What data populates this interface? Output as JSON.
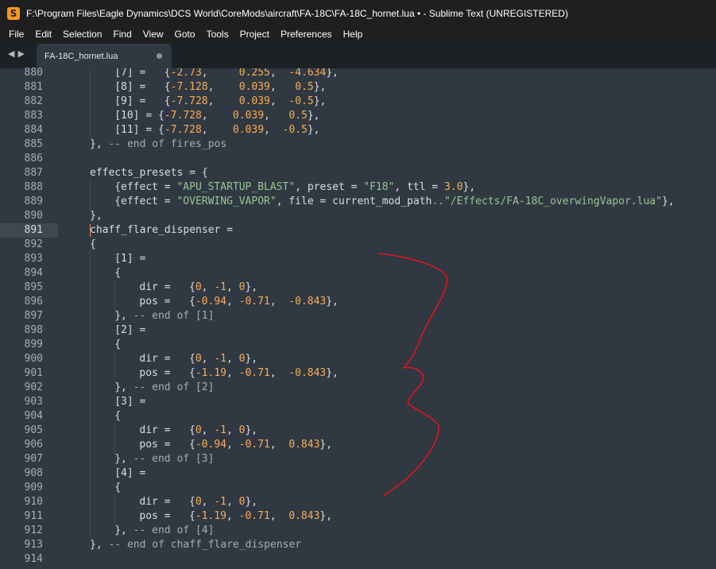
{
  "window": {
    "title": "F:\\Program Files\\Eagle Dynamics\\DCS World\\CoreMods\\aircraft\\FA-18C\\FA-18C_hornet.lua • - Sublime Text (UNREGISTERED)",
    "app_icon_letter": "S",
    "app_icon_color": "#f79a1f"
  },
  "menu": [
    "File",
    "Edit",
    "Selection",
    "Find",
    "View",
    "Goto",
    "Tools",
    "Project",
    "Preferences",
    "Help"
  ],
  "tabs": [
    {
      "label": "FA-18C_hornet.lua",
      "modified": true
    }
  ],
  "nav": {
    "back": "◀",
    "forward": "▶"
  },
  "editor": {
    "current_line": 891,
    "colors": {
      "background": "#303841",
      "number": "#f9ae58",
      "string": "#99c794",
      "comment": "#a6acb9",
      "text": "#d8dee9"
    },
    "lines": [
      {
        "n": 880,
        "indent": 2,
        "tokens": [
          [
            "t",
            "[7] =   {"
          ],
          [
            "n",
            "-2.73"
          ],
          [
            "t",
            ",     "
          ],
          [
            "n",
            "0.255"
          ],
          [
            "t",
            ",  "
          ],
          [
            "n",
            "-4.634"
          ],
          [
            "t",
            "},"
          ]
        ]
      },
      {
        "n": 881,
        "indent": 2,
        "tokens": [
          [
            "t",
            "[8] =   {"
          ],
          [
            "n",
            "-7.128"
          ],
          [
            "t",
            ",    "
          ],
          [
            "n",
            "0.039"
          ],
          [
            "t",
            ",   "
          ],
          [
            "n",
            "0.5"
          ],
          [
            "t",
            "},"
          ]
        ]
      },
      {
        "n": 882,
        "indent": 2,
        "tokens": [
          [
            "t",
            "[9] =   {"
          ],
          [
            "n",
            "-7.728"
          ],
          [
            "t",
            ",    "
          ],
          [
            "n",
            "0.039"
          ],
          [
            "t",
            ",  "
          ],
          [
            "n",
            "-0.5"
          ],
          [
            "t",
            "},"
          ]
        ]
      },
      {
        "n": 883,
        "indent": 2,
        "tokens": [
          [
            "t",
            "[10] = {"
          ],
          [
            "n",
            "-7.728"
          ],
          [
            "t",
            ",    "
          ],
          [
            "n",
            "0.039"
          ],
          [
            "t",
            ",   "
          ],
          [
            "n",
            "0.5"
          ],
          [
            "t",
            "},"
          ]
        ]
      },
      {
        "n": 884,
        "indent": 2,
        "tokens": [
          [
            "t",
            "[11] = {"
          ],
          [
            "n",
            "-7.728"
          ],
          [
            "t",
            ",    "
          ],
          [
            "n",
            "0.039"
          ],
          [
            "t",
            ",  "
          ],
          [
            "n",
            "-0.5"
          ],
          [
            "t",
            "},"
          ]
        ]
      },
      {
        "n": 885,
        "indent": 1,
        "tokens": [
          [
            "t",
            "}, "
          ],
          [
            "c",
            "-- end of fires_pos"
          ]
        ]
      },
      {
        "n": 886,
        "indent": 0,
        "tokens": []
      },
      {
        "n": 887,
        "indent": 1,
        "tokens": [
          [
            "t",
            "effects_presets = {"
          ]
        ]
      },
      {
        "n": 888,
        "indent": 2,
        "tokens": [
          [
            "t",
            "{effect = "
          ],
          [
            "s",
            "\"APU_STARTUP_BLAST\""
          ],
          [
            "t",
            ", preset = "
          ],
          [
            "s",
            "\"F18\""
          ],
          [
            "t",
            ", ttl = "
          ],
          [
            "n",
            "3.0"
          ],
          [
            "t",
            "},"
          ]
        ]
      },
      {
        "n": 889,
        "indent": 2,
        "tokens": [
          [
            "t",
            "{effect = "
          ],
          [
            "s",
            "\"OVERWING_VAPOR\""
          ],
          [
            "t",
            ", file = current_mod_path"
          ],
          [
            "c",
            ".."
          ],
          [
            "s",
            "\"/Effects/FA-18C_overwingVapor.lua\""
          ],
          [
            "t",
            "},"
          ]
        ]
      },
      {
        "n": 890,
        "indent": 1,
        "tokens": [
          [
            "t",
            "},"
          ]
        ]
      },
      {
        "n": 891,
        "indent": 1,
        "tokens": [
          [
            "t",
            "chaff_flare_dispenser = "
          ]
        ]
      },
      {
        "n": 892,
        "indent": 1,
        "tokens": [
          [
            "t",
            "{"
          ]
        ]
      },
      {
        "n": 893,
        "indent": 2,
        "tokens": [
          [
            "t",
            "[1] = "
          ]
        ]
      },
      {
        "n": 894,
        "indent": 2,
        "tokens": [
          [
            "t",
            "{"
          ]
        ]
      },
      {
        "n": 895,
        "indent": 3,
        "tokens": [
          [
            "t",
            "dir =   {"
          ],
          [
            "n",
            "0"
          ],
          [
            "t",
            ", "
          ],
          [
            "n",
            "-1"
          ],
          [
            "t",
            ", "
          ],
          [
            "n",
            "0"
          ],
          [
            "t",
            "},"
          ]
        ]
      },
      {
        "n": 896,
        "indent": 3,
        "tokens": [
          [
            "t",
            "pos =   {"
          ],
          [
            "n",
            "-0.94"
          ],
          [
            "t",
            ", "
          ],
          [
            "n",
            "-0.71"
          ],
          [
            "t",
            ",  "
          ],
          [
            "n",
            "-0.843"
          ],
          [
            "t",
            "},"
          ]
        ]
      },
      {
        "n": 897,
        "indent": 2,
        "tokens": [
          [
            "t",
            "}, "
          ],
          [
            "c",
            "-- end of [1]"
          ]
        ]
      },
      {
        "n": 898,
        "indent": 2,
        "tokens": [
          [
            "t",
            "[2] = "
          ]
        ]
      },
      {
        "n": 899,
        "indent": 2,
        "tokens": [
          [
            "t",
            "{"
          ]
        ]
      },
      {
        "n": 900,
        "indent": 3,
        "tokens": [
          [
            "t",
            "dir =   {"
          ],
          [
            "n",
            "0"
          ],
          [
            "t",
            ", "
          ],
          [
            "n",
            "-1"
          ],
          [
            "t",
            ", "
          ],
          [
            "n",
            "0"
          ],
          [
            "t",
            "},"
          ]
        ]
      },
      {
        "n": 901,
        "indent": 3,
        "tokens": [
          [
            "t",
            "pos =   {"
          ],
          [
            "n",
            "-1.19"
          ],
          [
            "t",
            ", "
          ],
          [
            "n",
            "-0.71"
          ],
          [
            "t",
            ",  "
          ],
          [
            "n",
            "-0.843"
          ],
          [
            "t",
            "},"
          ]
        ]
      },
      {
        "n": 902,
        "indent": 2,
        "tokens": [
          [
            "t",
            "}, "
          ],
          [
            "c",
            "-- end of [2]"
          ]
        ]
      },
      {
        "n": 903,
        "indent": 2,
        "tokens": [
          [
            "t",
            "[3] = "
          ]
        ]
      },
      {
        "n": 904,
        "indent": 2,
        "tokens": [
          [
            "t",
            "{"
          ]
        ]
      },
      {
        "n": 905,
        "indent": 3,
        "tokens": [
          [
            "t",
            "dir =   {"
          ],
          [
            "n",
            "0"
          ],
          [
            "t",
            ", "
          ],
          [
            "n",
            "-1"
          ],
          [
            "t",
            ", "
          ],
          [
            "n",
            "0"
          ],
          [
            "t",
            "},"
          ]
        ]
      },
      {
        "n": 906,
        "indent": 3,
        "tokens": [
          [
            "t",
            "pos =   {"
          ],
          [
            "n",
            "-0.94"
          ],
          [
            "t",
            ", "
          ],
          [
            "n",
            "-0.71"
          ],
          [
            "t",
            ",  "
          ],
          [
            "n",
            "0.843"
          ],
          [
            "t",
            "},"
          ]
        ]
      },
      {
        "n": 907,
        "indent": 2,
        "tokens": [
          [
            "t",
            "}, "
          ],
          [
            "c",
            "-- end of [3]"
          ]
        ]
      },
      {
        "n": 908,
        "indent": 2,
        "tokens": [
          [
            "t",
            "[4] = "
          ]
        ]
      },
      {
        "n": 909,
        "indent": 2,
        "tokens": [
          [
            "t",
            "{"
          ]
        ]
      },
      {
        "n": 910,
        "indent": 3,
        "tokens": [
          [
            "t",
            "dir =   {"
          ],
          [
            "n",
            "0"
          ],
          [
            "t",
            ", "
          ],
          [
            "n",
            "-1"
          ],
          [
            "t",
            ", "
          ],
          [
            "n",
            "0"
          ],
          [
            "t",
            "},"
          ]
        ]
      },
      {
        "n": 911,
        "indent": 3,
        "tokens": [
          [
            "t",
            "pos =   {"
          ],
          [
            "n",
            "-1.19"
          ],
          [
            "t",
            ", "
          ],
          [
            "n",
            "-0.71"
          ],
          [
            "t",
            ",  "
          ],
          [
            "n",
            "0.843"
          ],
          [
            "t",
            "},"
          ]
        ]
      },
      {
        "n": 912,
        "indent": 2,
        "tokens": [
          [
            "t",
            "}, "
          ],
          [
            "c",
            "-- end of [4]"
          ]
        ]
      },
      {
        "n": 913,
        "indent": 1,
        "tokens": [
          [
            "t",
            "}, "
          ],
          [
            "c",
            "-- end of chaff_flare_dispenser"
          ]
        ]
      },
      {
        "n": 914,
        "indent": 0,
        "tokens": []
      }
    ]
  },
  "annotation": {
    "type": "freehand-squiggle",
    "color": "#e0161c"
  }
}
